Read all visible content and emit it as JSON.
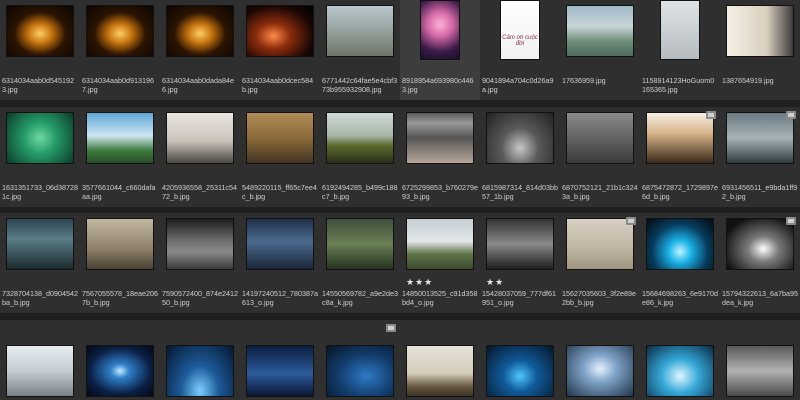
{
  "app": {
    "title": ""
  },
  "grid": {
    "rows": [
      [
        {
          "file": "6314034aab0d5451923.jpg",
          "fx": "fx-candle"
        },
        {
          "file": "6314034aab0d9131967.jpg",
          "fx": "fx-candle"
        },
        {
          "file": "6314034aab0dada84e6.jpg",
          "fx": "fx-candle"
        },
        {
          "file": "6314034aab0dcec584b.jpg",
          "fx": "fx-dark-red"
        },
        {
          "file": "6771442c64fae5e4cbf373b955932908.jpg",
          "fx": "fx-beach"
        },
        {
          "file": "8918954a693980c4463.jpg",
          "fx": "fx-pink",
          "portrait": true
        },
        {
          "file": "9041894a704c0d26a9a.jpg",
          "fx": "fx-white",
          "portrait": true,
          "thumb_text": "Cảm ơn cuộc đời"
        },
        {
          "file": "17636959.jpg",
          "fx": "fx-lake"
        },
        {
          "file": "1158914123HoGuom0165365.jpg",
          "fx": "fx-tree",
          "portrait": true
        },
        {
          "file": "1387654919.jpg",
          "fx": "fx-cartoon"
        }
      ],
      [
        {
          "file": "1631351733_06d387281c.jpg",
          "fx": "fx-green"
        },
        {
          "file": "3577661044_c660dafaaa.jpg",
          "fx": "fx-park"
        },
        {
          "file": "4205936558_25311c5472_b.jpg",
          "fx": "fx-bw"
        },
        {
          "file": "5489220115_ff65c7ee4c_b.jpg",
          "fx": "fx-reeds"
        },
        {
          "file": "6192494285_b499c188c7_b.jpg",
          "fx": "fx-field"
        },
        {
          "file": "6725299853_b760279e93_b.jpg",
          "fx": "fx-cup"
        },
        {
          "file": "6815987314_814d03bb57_1b.jpg",
          "fx": "fx-rain"
        },
        {
          "file": "6870752121_21b1c3243a_b.jpg",
          "fx": "fx-gray"
        },
        {
          "file": "6875472872_1729897e6d_b.jpg",
          "fx": "fx-sunset",
          "badge": true
        },
        {
          "file": "6931456511_e9bda1ff92_b.jpg",
          "fx": "fx-shoes",
          "badge": true
        }
      ],
      [
        {
          "file": "7328704138_d0904542ba_b.jpg",
          "fx": "fx-road"
        },
        {
          "file": "7567055578_18eae2067b_b.jpg",
          "fx": "fx-sepia"
        },
        {
          "file": "7590572400_874e241250_b.jpg",
          "fx": "fx-cloud"
        },
        {
          "file": "14197240512_780387a613_o.jpg",
          "fx": "fx-storm"
        },
        {
          "file": "14550569782_a9e2de3c8a_k.jpg",
          "fx": "fx-forest"
        },
        {
          "file": "14850013525_c91d358bd4_o.jpg",
          "fx": "fx-hill",
          "stars": "★★★"
        },
        {
          "file": "15428037059_777df61951_o.jpg",
          "fx": "fx-mono",
          "stars": "★★"
        },
        {
          "file": "15627035603_3f2e89e2bb_b.jpg",
          "fx": "fx-sand",
          "badge": true
        },
        {
          "file": "15684698263_6e9170de86_k.jpg",
          "fx": "fx-glow"
        },
        {
          "file": "15794322613_6a7ba95dea_k.jpg",
          "fx": "fx-spot",
          "badge": true
        }
      ],
      [
        {
          "file": "",
          "fx": "fx-shore"
        },
        {
          "file": "",
          "fx": "fx-beam"
        },
        {
          "file": "",
          "fx": "fx-horizon"
        },
        {
          "file": "",
          "fx": "fx-night"
        },
        {
          "file": "",
          "fx": "fx-blue2",
          "badge": true
        },
        {
          "file": "",
          "fx": "fx-oak"
        },
        {
          "file": "",
          "fx": "fx-planet"
        },
        {
          "file": "",
          "fx": "fx-sky"
        },
        {
          "file": "",
          "fx": "fx-ice"
        },
        {
          "file": "",
          "fx": "fx-mist"
        }
      ]
    ]
  }
}
